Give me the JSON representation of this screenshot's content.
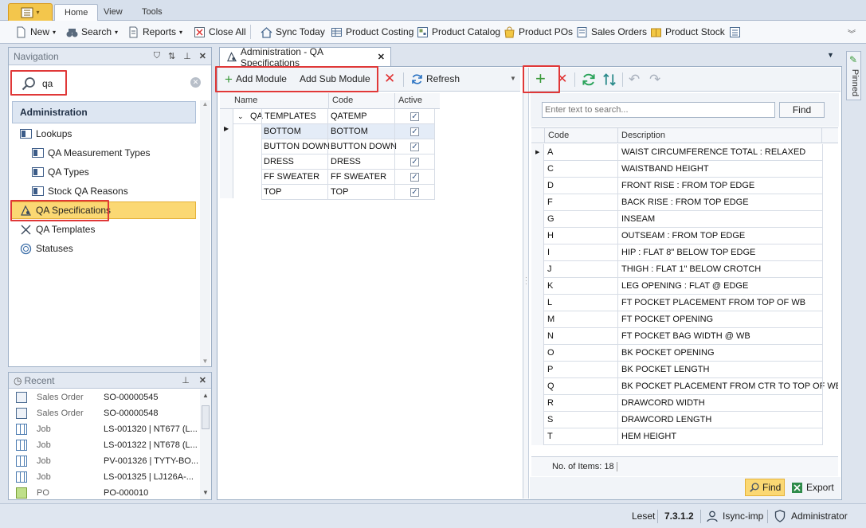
{
  "ribbon": {
    "tabs": [
      {
        "label": "Home"
      },
      {
        "label": "View"
      },
      {
        "label": "Tools"
      }
    ],
    "buttons": {
      "new": "New",
      "search": "Search",
      "reports": "Reports",
      "close_all": "Close All",
      "sync_today": "Sync Today",
      "product_costing": "Product Costing",
      "product_catalog": "Product Catalog",
      "product_pos": "Product POs",
      "sales_orders": "Sales Orders",
      "product_stock": "Product Stock"
    }
  },
  "navigation": {
    "title": "Navigation",
    "search_value": "qa",
    "group": "Administration",
    "items": [
      {
        "label": "Lookups",
        "icon": "lookup-icon"
      },
      {
        "label": "QA Measurement Types",
        "icon": "lookup-icon"
      },
      {
        "label": "QA Types",
        "icon": "lookup-icon"
      },
      {
        "label": "Stock QA Reasons",
        "icon": "lookup-icon"
      },
      {
        "label": "QA Specifications",
        "icon": "qa-spec-icon"
      },
      {
        "label": "QA Templates",
        "icon": "qa-template-icon"
      },
      {
        "label": "Statuses",
        "icon": "status-icon"
      }
    ]
  },
  "recent": {
    "title": "Recent",
    "rows": [
      {
        "type": "Sales Order",
        "value": "SO-00000545"
      },
      {
        "type": "Sales Order",
        "value": "SO-00000548"
      },
      {
        "type": "Job",
        "value": "LS-001320 | NT677 (L..."
      },
      {
        "type": "Job",
        "value": "LS-001322 | NT678 (L..."
      },
      {
        "type": "Job",
        "value": "PV-001326 | TYTY-BO..."
      },
      {
        "type": "Job",
        "value": "LS-001325 | LJ126A-..."
      },
      {
        "type": "PO",
        "value": "PO-000010"
      }
    ]
  },
  "document_tab": {
    "title": "Administration - QA Specifications"
  },
  "left_toolbar": {
    "add_module": "Add Module",
    "add_sub_module": "Add Sub Module",
    "refresh": "Refresh"
  },
  "tree": {
    "columns": [
      "Name",
      "Code",
      "Active"
    ],
    "root": {
      "name": "QA TEMPLATES",
      "code": "QATEMP",
      "active": true
    },
    "children": [
      {
        "name": "BOTTOM",
        "code": "BOTTOM",
        "active": true
      },
      {
        "name": "BUTTON DOWN",
        "code": "BUTTON DOWN",
        "active": true
      },
      {
        "name": "DRESS",
        "code": "DRESS",
        "active": true
      },
      {
        "name": "FF SWEATER",
        "code": "FF SWEATER",
        "active": true
      },
      {
        "name": "TOP",
        "code": "TOP",
        "active": true
      }
    ]
  },
  "right_panel": {
    "search_placeholder": "Enter text to search...",
    "find_button": "Find",
    "columns": [
      "Code",
      "Description"
    ],
    "rows": [
      {
        "code": "A",
        "description": "WAIST CIRCUMFERENCE TOTAL : RELAXED"
      },
      {
        "code": "C",
        "description": "WAISTBAND HEIGHT"
      },
      {
        "code": "D",
        "description": "FRONT RISE : FROM TOP EDGE"
      },
      {
        "code": "F",
        "description": "BACK RISE : FROM TOP EDGE"
      },
      {
        "code": "G",
        "description": "INSEAM"
      },
      {
        "code": "H",
        "description": "OUTSEAM : FROM TOP EDGE"
      },
      {
        "code": "I",
        "description": "HIP : FLAT 8\" BELOW TOP EDGE"
      },
      {
        "code": "J",
        "description": "THIGH : FLAT 1\" BELOW CROTCH"
      },
      {
        "code": "K",
        "description": "LEG OPENING : FLAT @ EDGE"
      },
      {
        "code": "L",
        "description": "FT POCKET PLACEMENT FROM TOP OF WB"
      },
      {
        "code": "M",
        "description": "FT POCKET OPENING"
      },
      {
        "code": "N",
        "description": "FT POCKET BAG WIDTH @ WB"
      },
      {
        "code": "O",
        "description": "BK POCKET OPENING"
      },
      {
        "code": "P",
        "description": "BK POCKET LENGTH"
      },
      {
        "code": "Q",
        "description": "BK POCKET PLACEMENT FROM CTR TO TOP OF WB"
      },
      {
        "code": "R",
        "description": "DRAWCORD WIDTH"
      },
      {
        "code": "S",
        "description": "DRAWCORD LENGTH"
      },
      {
        "code": "T",
        "description": "HEM HEIGHT"
      }
    ],
    "footer": "No. of Items: 18",
    "bottom_find": "Find",
    "bottom_export": "Export"
  },
  "pinned_label": "Pinned",
  "status_bar": {
    "company": "Leset",
    "version": "7.3.1.2",
    "user": "Isync-imp",
    "role": "Administrator"
  },
  "colors": {
    "highlight_red": "#e03838",
    "selection_orange": "#fbd873",
    "ribbon_bg": "#f6f8fb",
    "nav_header_blue": "#dde6f2"
  }
}
